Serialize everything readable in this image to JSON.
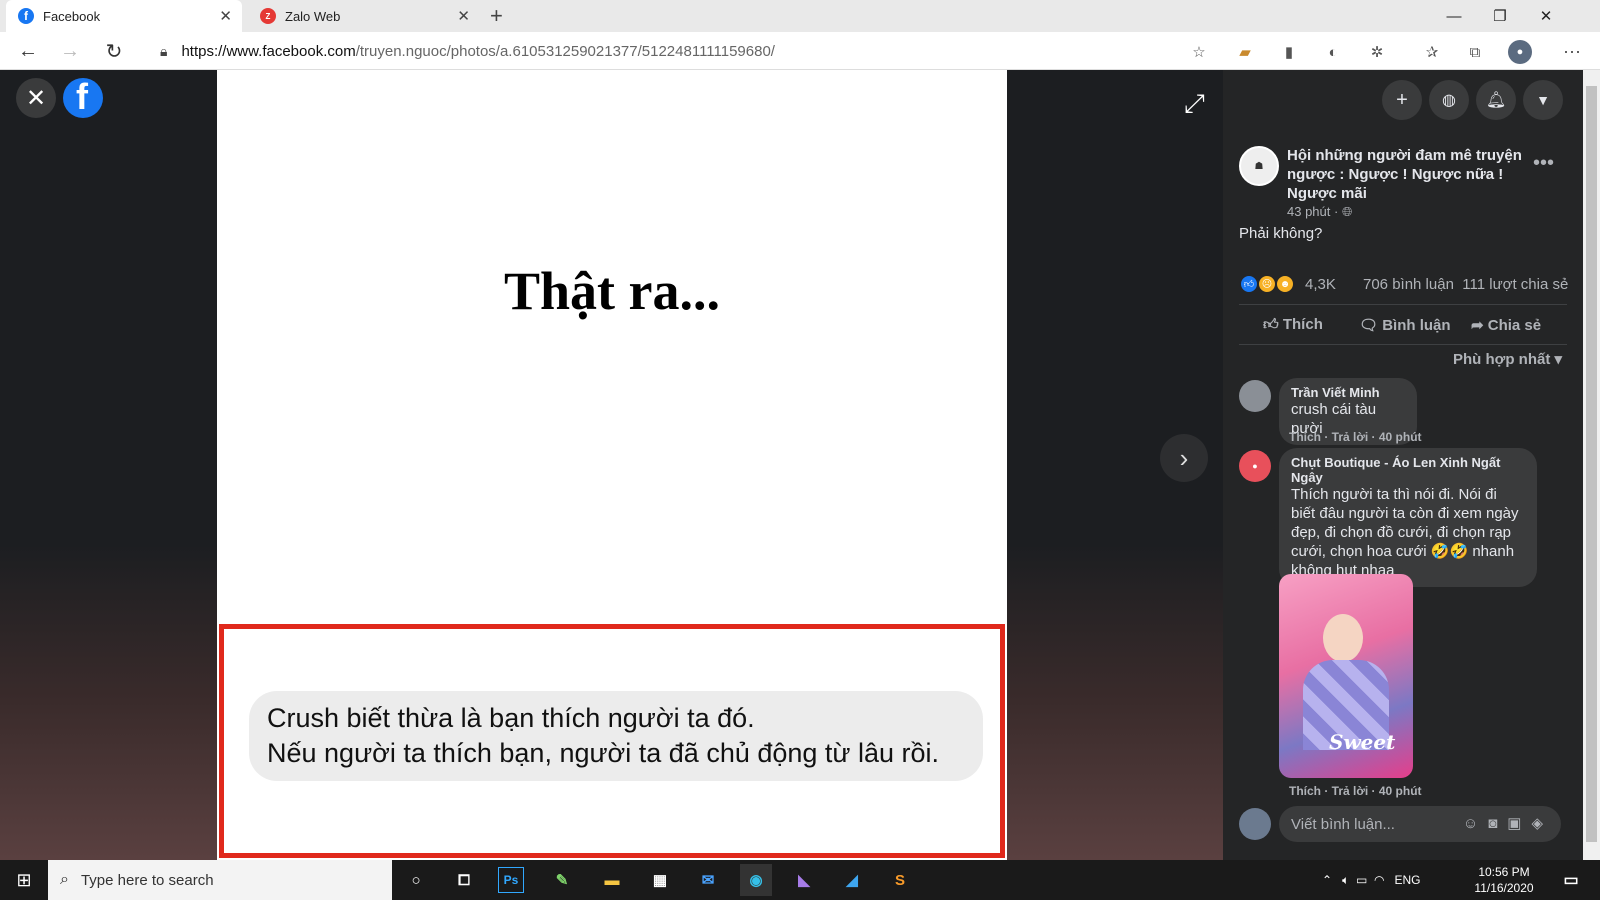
{
  "browser": {
    "tabs": [
      {
        "label": "Facebook",
        "active": true
      },
      {
        "label": "Zalo Web",
        "active": false
      }
    ],
    "url_host": "https://www.facebook.com",
    "url_path": "/truyen.nguoc/photos/a.610531259021377/5122481111159680/"
  },
  "photo": {
    "title": "Thật ra...",
    "bubble_line1": "Crush biết thừa là bạn thích người ta đó.",
    "bubble_line2": "Nếu người ta thích bạn, người ta đã chủ động từ lâu rồi."
  },
  "post": {
    "group_name": "Hội những người đam mê truyện ngược : Ngược ! Ngược nữa ! Ngược mãi",
    "time": "43 phút ·",
    "caption": "Phải không?",
    "reaction_count": "4,3K",
    "comment_count": "706 bình luận",
    "share_count": "111 lượt chia sẻ",
    "actions": {
      "like": "Thích",
      "comment": "Bình luận",
      "share": "Chia sẻ"
    },
    "sort_label": "Phù hợp nhất"
  },
  "comments": [
    {
      "author": "Trần Viết Minh",
      "text": "crush cái tàu pười",
      "meta": "Thích · Trả lời · 40 phút"
    },
    {
      "author": "Chụt Boutique - Áo Len Xinh Ngất Ngây",
      "text": "Thích người ta thì nói đi. Nói đi biết đâu người ta còn đi xem ngày đẹp, đi chọn đồ cưới, đi chọn rạp cưới, chọn hoa cưới 🤣🤣 nhanh không hụt nhaa",
      "meta": "Thích · Trả lời · 40 phút",
      "image_text": "Sweet"
    }
  ],
  "comment_input": {
    "placeholder": "Viết bình luận..."
  },
  "taskbar": {
    "search_placeholder": "Type here to search",
    "language": "ENG",
    "time": "10:56 PM",
    "date": "11/16/2020"
  },
  "colors": {
    "facebook_blue": "#1877f2",
    "highlight_red": "#e0291c",
    "panel_bg": "#242526"
  }
}
